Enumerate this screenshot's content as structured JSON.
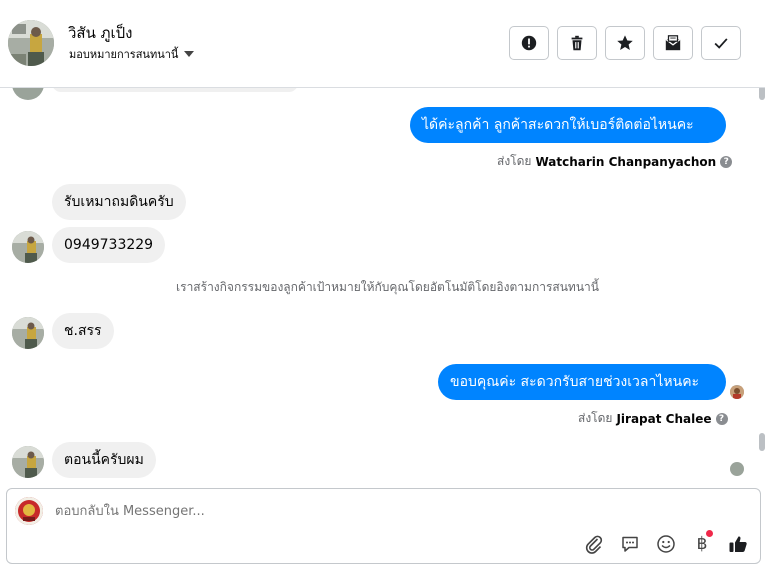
{
  "header": {
    "contact_name": "วิสัน ภูเป็ง",
    "assign_label": "มอบหมายการสนทนานี้"
  },
  "messages": [
    {
      "direction": "out",
      "text": "ได้ค่ะลูกค้า ลูกค้าสะดวกให้เบอร์ติดต่อไหนคะ",
      "sent_by_prefix": "ส่งโดย",
      "sent_by_name": "Watcharin Chanpanyachon"
    },
    {
      "direction": "in",
      "text": "รับเหมาถมดินครับ"
    },
    {
      "direction": "in",
      "text": "0949733229"
    },
    {
      "direction": "system",
      "text": "เราสร้างกิจกรรมของลูกค้าเป้าหมายให้กับคุณโดยอัตโนมัติโดยอิงตามการสนทนานี้"
    },
    {
      "direction": "in",
      "text": "ช.สรร"
    },
    {
      "direction": "out",
      "text": "ขอบคุณค่ะ สะดวกรับสายช่วงเวลาไหนคะ",
      "sent_by_prefix": "ส่งโดย",
      "sent_by_name": "Jirapat Chalee"
    },
    {
      "direction": "in",
      "text": "ตอนนี้ครับผม"
    }
  ],
  "composer": {
    "placeholder": "ตอบกลับใน Messenger..."
  },
  "icons": [
    "alert-icon",
    "trash-icon",
    "star-icon",
    "mark-unread-icon",
    "check-icon",
    "attachment-icon",
    "saved-reply-icon",
    "emoji-icon",
    "baht-payment-icon",
    "like-icon"
  ],
  "colors": {
    "outgoing_bubble": "#0084ff",
    "incoming_bubble": "#f0f0f0",
    "notification_dot": "#f02849"
  }
}
